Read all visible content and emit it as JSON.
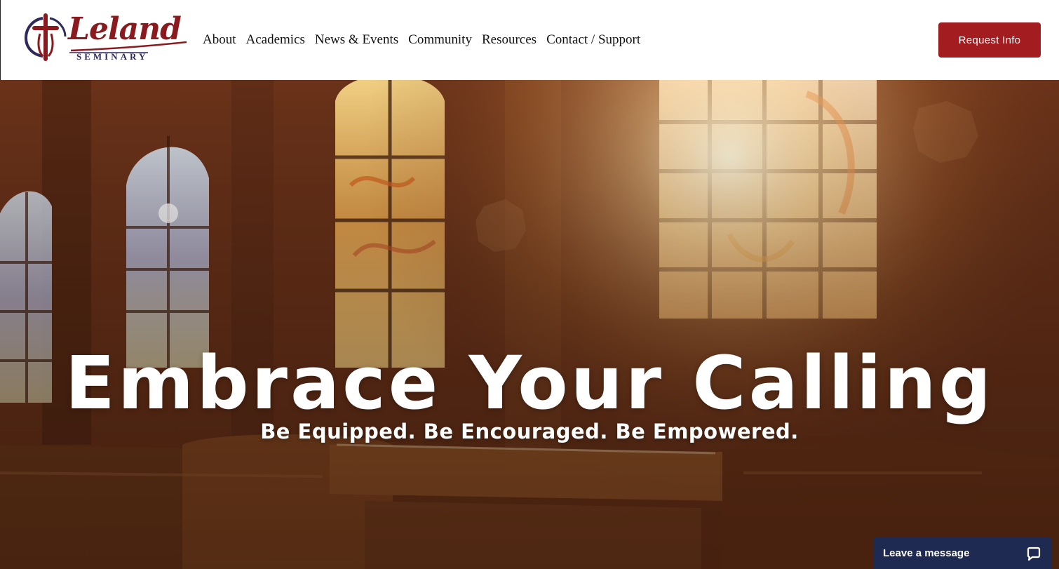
{
  "brand": {
    "name": "Leland",
    "subtitle": "SEMINARY",
    "primary_color": "#8b1a1f",
    "secondary_color": "#2e2a5c"
  },
  "nav": {
    "items": [
      {
        "label": "About"
      },
      {
        "label": "Academics"
      },
      {
        "label": "News & Events"
      },
      {
        "label": "Community"
      },
      {
        "label": "Resources"
      },
      {
        "label": "Contact / Support"
      }
    ]
  },
  "header": {
    "cta_label": "Request Info",
    "cta_color": "#a31c1f"
  },
  "hero": {
    "title": "Embrace Your Calling",
    "subtitle": "Be Equipped. Be Encouraged. Be Empowered.",
    "background": "chapel interior with stained glass windows and wooden pews"
  },
  "chat": {
    "label": "Leave a message",
    "icon": "chat-bubble-icon",
    "color": "#1f2a52"
  }
}
